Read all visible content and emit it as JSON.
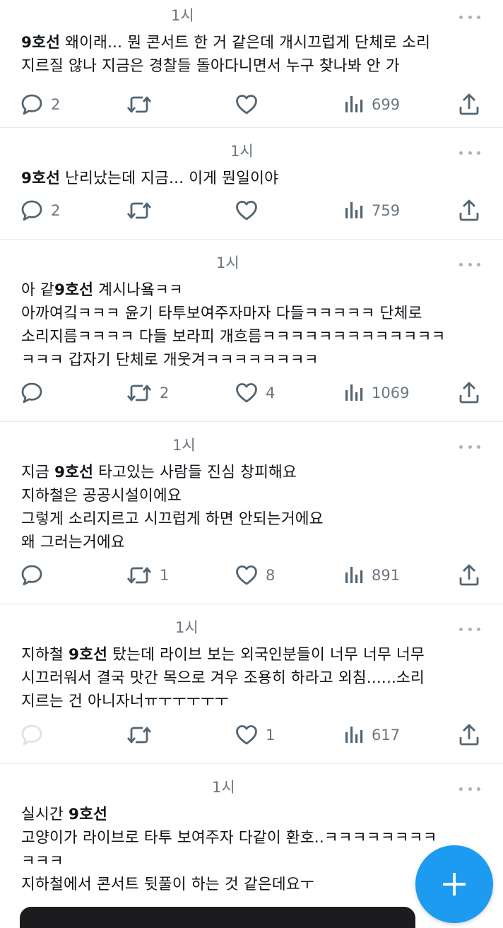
{
  "tweets": [
    {
      "time": "1시",
      "lines": [
        [
          {
            "t": "9호선",
            "b": true
          },
          {
            "t": " 왜이래... 뭔 콘서트 한 거 같은데 개시끄럽게 단체로 소리"
          }
        ],
        [
          {
            "t": "지르질 않나 지금은 경찰들 돌아다니면서 누구 찾나봐 안 가"
          }
        ]
      ],
      "replies": "2",
      "retweets": "",
      "likes": "",
      "views": "699",
      "reply_faded": false
    },
    {
      "time": "1시",
      "lines": [
        [
          {
            "t": "9호선",
            "b": true
          },
          {
            "t": " 난리났는데 지금... 이게 뭔일이야"
          }
        ]
      ],
      "replies": "2",
      "retweets": "",
      "likes": "",
      "views": "759",
      "reply_faded": false
    },
    {
      "time": "1시",
      "lines": [
        [
          {
            "t": "아 같"
          },
          {
            "t": "9호선",
            "b": true
          },
          {
            "t": " 계시나욬ㅋㅋ"
          }
        ],
        [
          {
            "t": "아까여깈ㅋㅋㅋ 윤기 타투보여주자마자 다들ㅋㅋㅋㅋㅋ 단체로"
          }
        ],
        [
          {
            "t": "소리지름ㅋㅋㅋㅋ 다들 보라피 개흐름ㅋㅋㅋㅋㅋㅋㅋㅋㅋㅋㅋㅋㅋ"
          }
        ],
        [
          {
            "t": "ㅋㅋㅋ 갑자기 단체로 개웃겨ㅋㅋㅋㅋㅋㅋㅋㅋ"
          }
        ]
      ],
      "replies": "",
      "retweets": "2",
      "likes": "4",
      "views": "1069",
      "reply_faded": false
    },
    {
      "time": "1시",
      "lines": [
        [
          {
            "t": "지금 "
          },
          {
            "t": "9호선",
            "b": true
          },
          {
            "t": " 타고있는 사람들 진심 창피해요"
          }
        ],
        [
          {
            "t": "지하철은 공공시설이에요"
          }
        ],
        [
          {
            "t": "그렇게 소리지르고 시끄럽게 하면 안되는거에요"
          }
        ],
        [
          {
            "t": "왜 그러는거에요"
          }
        ]
      ],
      "replies": "",
      "retweets": "1",
      "likes": "8",
      "views": "891",
      "reply_faded": false
    },
    {
      "time": "1시",
      "lines": [
        [
          {
            "t": "지하철 "
          },
          {
            "t": "9호선",
            "b": true
          },
          {
            "t": " 탔는데 라이브 보는 외국인분들이 너무 너무 너무"
          }
        ],
        [
          {
            "t": "시끄러워서 결국 맛간 목으로 겨우 조용히 하라고 외침......소리"
          }
        ],
        [
          {
            "t": "지르는 건 아니자너ㅠㅜㅜㅜㅜㅜ"
          }
        ]
      ],
      "replies": "",
      "retweets": "",
      "likes": "1",
      "views": "617",
      "reply_faded": true
    },
    {
      "time": "1시",
      "lines": [
        [
          {
            "t": "실시간 "
          },
          {
            "t": "9호선",
            "b": true
          }
        ],
        [
          {
            "t": "고양이가 라이브로 타투 보여주자 다같이 환호..ㅋㅋㅋㅋㅋㅋㅋㅋ"
          }
        ],
        [
          {
            "t": "ㅋㅋㅋ"
          }
        ],
        [
          {
            "t": "지하철에서 콘서트 뒷풀이 하는 것 같은데요ㅜ"
          }
        ]
      ],
      "replies": "",
      "retweets": "",
      "likes": "",
      "views": "",
      "reply_faded": false
    }
  ],
  "icons": {
    "reply": "reply-icon",
    "retweet": "retweet-icon",
    "like": "heart-icon",
    "views": "views-icon",
    "share": "share-icon",
    "more": "more-icon",
    "compose": "plus-icon"
  },
  "colors": {
    "accent": "#1d9bf0",
    "muted": "#6b7680",
    "icon": "#536471",
    "divider": "#e6e9ec"
  }
}
